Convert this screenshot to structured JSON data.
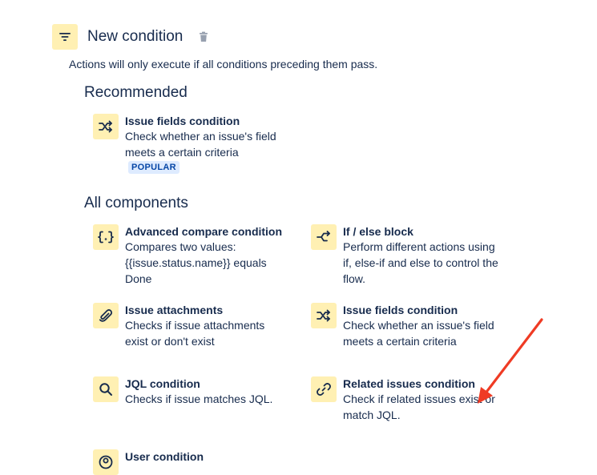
{
  "header": {
    "title": "New condition",
    "subtitle": "Actions will only execute if all conditions preceding them pass.",
    "icon": "filter-icon",
    "delete_icon": "trash-icon"
  },
  "recommended": {
    "heading": "Recommended",
    "items": [
      {
        "title": "Issue fields condition",
        "desc_lines": [
          "Check whether an issue's field",
          "meets a certain criteria"
        ],
        "badge": "POPULAR",
        "icon": "shuffle-icon"
      }
    ]
  },
  "all": {
    "heading": "All components",
    "items": [
      {
        "title": "Advanced compare condition",
        "desc_lines": [
          "Compares two values:",
          "{{issue.status.name}} equals",
          "Done"
        ],
        "icon": "curly-braces-icon"
      },
      {
        "title": "If / else block",
        "desc_lines": [
          "Perform different actions using",
          "if, else-if and else to control the",
          "flow."
        ],
        "icon": "branch-icon"
      },
      {
        "title": "Issue attachments",
        "desc_lines": [
          "Checks if issue attachments",
          "exist or don't exist"
        ],
        "icon": "paperclip-icon"
      },
      {
        "title": "Issue fields condition",
        "desc_lines": [
          "Check whether an issue's field",
          "meets a certain criteria"
        ],
        "icon": "shuffle-icon"
      },
      {
        "title": "JQL condition",
        "desc_lines": [
          "Checks if issue matches JQL."
        ],
        "icon": "search-icon"
      },
      {
        "title": "Related issues condition",
        "desc_lines": [
          "Check if related issues exist or",
          "match JQL."
        ],
        "icon": "link-icon"
      },
      {
        "title": "User condition",
        "desc_lines": [],
        "icon": "user-icon"
      }
    ]
  },
  "colors": {
    "icon_bg": "#fff0b3",
    "text": "#172b4d",
    "badge_bg": "#deebff",
    "badge_text": "#0747a6",
    "annotation_arrow": "#ef3b24"
  }
}
